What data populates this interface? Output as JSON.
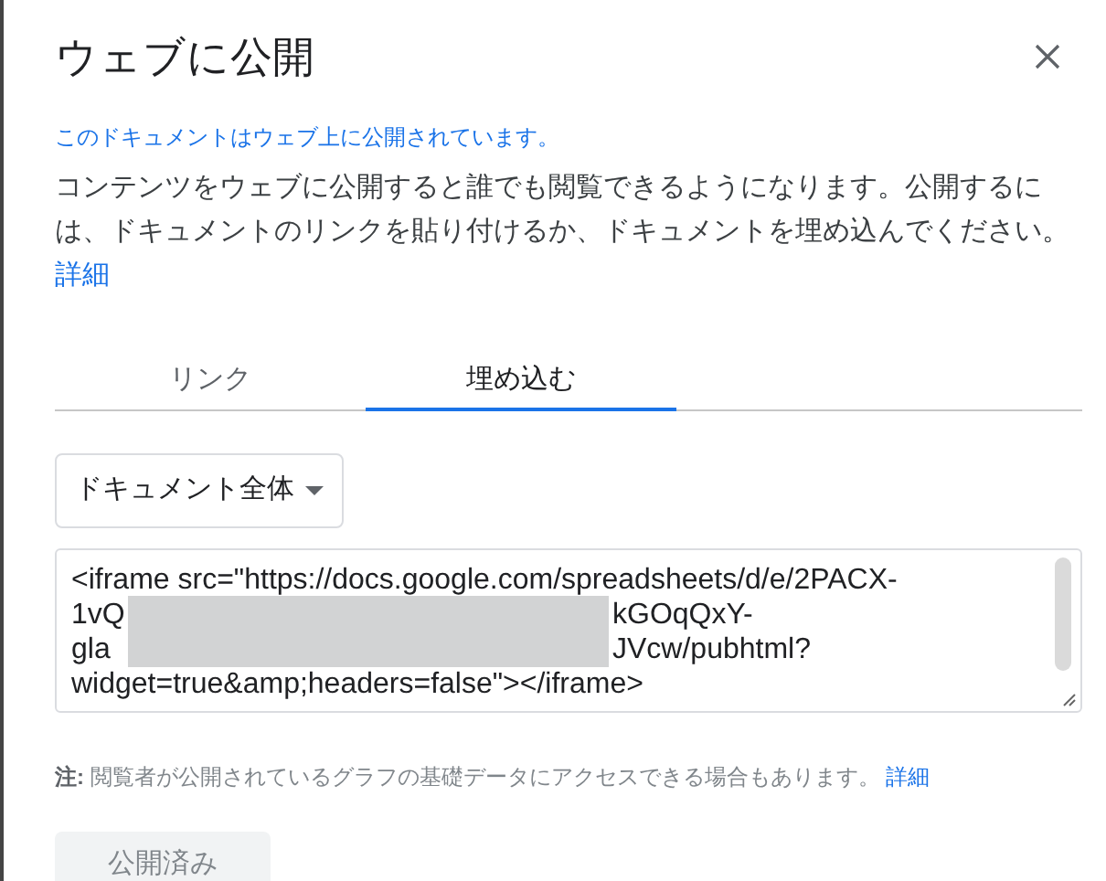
{
  "dialog": {
    "title": "ウェブに公開",
    "status": "このドキュメントはウェブ上に公開されています。",
    "description": {
      "text": "コンテンツをウェブに公開すると誰でも閲覧できるようになります。公開するには、ドキュメントのリンクを貼り付けるか、ドキュメントを埋め込んでください。",
      "link": "詳細"
    },
    "tabs": [
      {
        "label": "リンク",
        "selected": false
      },
      {
        "label": "埋め込む",
        "selected": true
      }
    ],
    "dropdown": "ドキュメント全体",
    "embed_code": [
      {
        "text": "<iframe src=\"https://docs.google.com/spreadsheets/d/e/2PACX-",
        "redacted": false
      },
      {
        "text": "1vQ",
        "after": "kGOqQxY-",
        "redacted": true
      },
      {
        "text": "gla",
        "after": "JVcw/pubhtml?",
        "redacted": true
      },
      {
        "text": "widget=true&amp;headers=false\"></iframe>",
        "redacted": false
      }
    ],
    "note": {
      "text": "**注:** 閲覧者が公開されているグラフの基礎データにアクセスできる場合もあります。",
      "link": "詳細"
    },
    "publish_button": {
      "label": "公開済み",
      "disabled": true
    }
  }
}
